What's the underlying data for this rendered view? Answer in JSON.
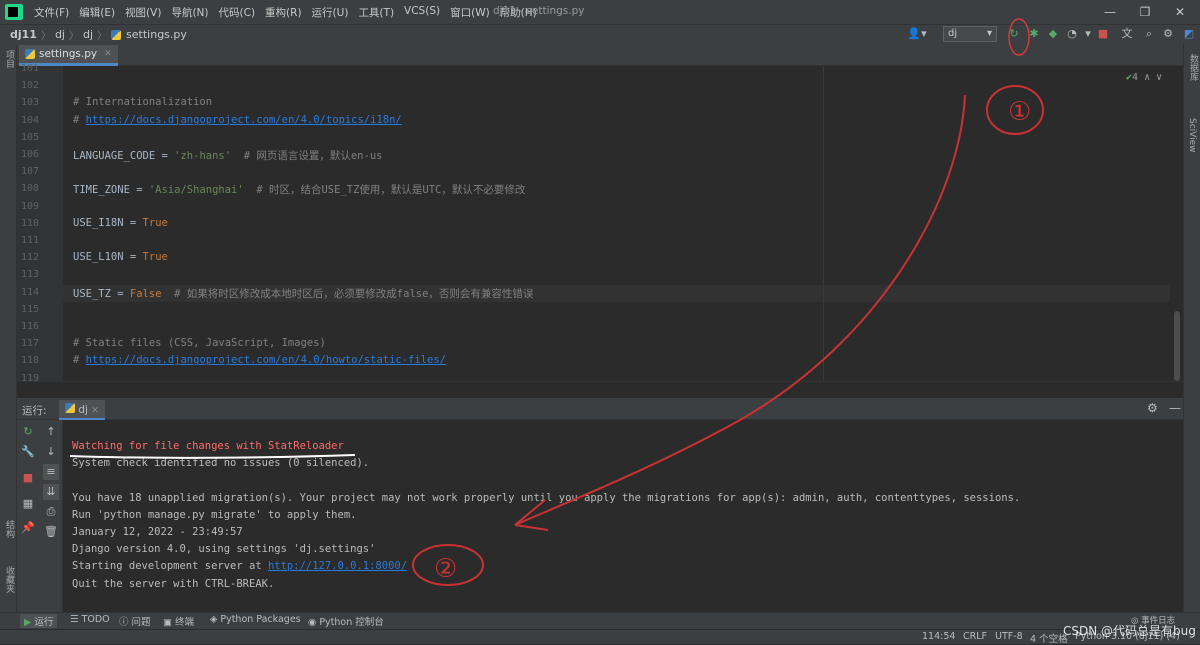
{
  "menubar": {
    "items": [
      "文件(F)",
      "编辑(E)",
      "视图(V)",
      "导航(N)",
      "代码(C)",
      "重构(R)",
      "运行(U)",
      "工具(T)",
      "VCS(S)",
      "窗口(W)",
      "帮助(H)"
    ],
    "window_title": "dj11 - settings.py"
  },
  "navbar": {
    "crumbs": [
      "dj11",
      "dj",
      "dj",
      "settings.py"
    ],
    "run_config": "dj"
  },
  "tabs": {
    "active": "settings.py"
  },
  "left_strip": {
    "project": "项目",
    "structure": "结构",
    "bookmarks": "收藏夹"
  },
  "right_strip": {
    "database": "数据库",
    "sciview": "SciView"
  },
  "editor": {
    "inspection": "4",
    "lines": [
      {
        "n": "101",
        "text": ""
      },
      {
        "n": "102",
        "text": ""
      },
      {
        "n": "103",
        "comment": "# Internationalization"
      },
      {
        "n": "104",
        "prefix": "# ",
        "link": "https://docs.djangoproject.com/en/4.0/topics/i18n/"
      },
      {
        "n": "105",
        "text": ""
      },
      {
        "n": "106",
        "code": "LANGUAGE_CODE = ",
        "str": "'zh-hans'",
        "comment": "  # 网页语言设置，默认en-us"
      },
      {
        "n": "107",
        "text": ""
      },
      {
        "n": "108",
        "code": "TIME_ZONE = ",
        "str": "'Asia/Shanghai'",
        "comment": "  # 时区，结合USE_TZ使用，默认是UTC，默认不必要修改"
      },
      {
        "n": "109",
        "text": ""
      },
      {
        "n": "110",
        "code": "USE_I18N = ",
        "kw": "True"
      },
      {
        "n": "111",
        "text": ""
      },
      {
        "n": "112",
        "code": "USE_L10N = ",
        "kw": "True"
      },
      {
        "n": "113",
        "text": ""
      },
      {
        "n": "114",
        "code": "USE_TZ = ",
        "kw": "False",
        "comment": "  # 如果将时区修改成本地时区后，必须要修改成false，否则会有兼容性错误"
      },
      {
        "n": "115",
        "text": ""
      },
      {
        "n": "116",
        "text": ""
      },
      {
        "n": "117",
        "comment": "# Static files (CSS, JavaScript, Images)"
      },
      {
        "n": "118",
        "prefix": "# ",
        "link": "https://docs.djangoproject.com/en/4.0/howto/static-files/"
      },
      {
        "n": "119",
        "text": ""
      }
    ]
  },
  "run": {
    "label": "运行:",
    "tab": "dj",
    "console": [
      {
        "text": "Watching for file changes with StatReloader",
        "red": true
      },
      {
        "text": "System check identified no issues (0 silenced)."
      },
      {
        "text": ""
      },
      {
        "text": "You have 18 unapplied migration(s). Your project may not work properly until you apply the migrations for app(s): admin, auth, contenttypes, sessions."
      },
      {
        "text": "Run 'python manage.py migrate' to apply them."
      },
      {
        "text": "January 12, 2022 - 23:49:57"
      },
      {
        "text": "Django version 4.0, using settings 'dj.settings'"
      },
      {
        "text": "Starting development server at ",
        "url": "http://127.0.0.1:8000/"
      },
      {
        "text": "Quit the server with CTRL-BREAK."
      }
    ]
  },
  "bottom_tabs": [
    "运行",
    "TODO",
    "问题",
    "终端",
    "Python Packages",
    "Python 控制台"
  ],
  "event_log": "事件日志",
  "status": {
    "position": "114:54",
    "line_sep": "CRLF",
    "encoding": "UTF-8",
    "indent": "4 个空格",
    "interpreter": "Python 3.10 (dj11) (4)"
  },
  "watermark": "CSDN @代码总是有bug",
  "annotations": {
    "circle1": "①",
    "circle2": "②"
  }
}
